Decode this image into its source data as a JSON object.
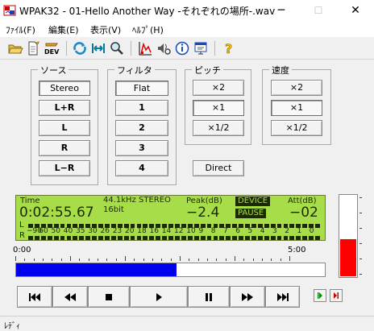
{
  "window": {
    "title": "WPAK32 - 01-Hello Another Way -それぞれの場所-.wav",
    "minimize": "─",
    "maximize": "☐",
    "close": "✕"
  },
  "menu": [
    {
      "label": "ﾌｧｲﾙ(F)"
    },
    {
      "label": "編集(E)"
    },
    {
      "label": "表示(V)"
    },
    {
      "label": "ﾍﾙﾌﾟ(H)"
    }
  ],
  "toolbar": {
    "icons": [
      "open-folder-icon",
      "new-document-icon",
      "dev-icon",
      "repeat-icon",
      "fit-width-icon",
      "zoom-icon",
      "spectrum-icon",
      "speaker-settings-icon",
      "info-icon",
      "window-icon",
      "help-icon"
    ],
    "dev_label": "DEV"
  },
  "source": {
    "title": "ソース",
    "buttons": [
      {
        "label": "Stereo",
        "pressed": true
      },
      {
        "label": "L+R",
        "pressed": false
      },
      {
        "label": "L",
        "pressed": false
      },
      {
        "label": "R",
        "pressed": false
      },
      {
        "label": "L−R",
        "pressed": false
      }
    ]
  },
  "filter": {
    "title": "フィルタ",
    "buttons": [
      {
        "label": "Flat",
        "pressed": true
      },
      {
        "label": "1",
        "pressed": false
      },
      {
        "label": "2",
        "pressed": false
      },
      {
        "label": "3",
        "pressed": false
      },
      {
        "label": "4",
        "pressed": false
      }
    ]
  },
  "pitch": {
    "title": "ピッチ",
    "buttons": [
      {
        "label": "×2",
        "pressed": false
      },
      {
        "label": "×1",
        "pressed": true
      },
      {
        "label": "×1/2",
        "pressed": false
      }
    ]
  },
  "speed": {
    "title": "速度",
    "buttons": [
      {
        "label": "×2",
        "pressed": false
      },
      {
        "label": "×1",
        "pressed": true
      },
      {
        "label": "×1/2",
        "pressed": false
      }
    ]
  },
  "direct_label": "Direct",
  "lcd": {
    "time_label": "Time",
    "time": "0:02:55.67",
    "format_line1": "44.1kHz STEREO",
    "format_line2": "16bit",
    "peak_label": "Peak(dB)",
    "peak": "−2.4",
    "device_label": "DEVICE",
    "pause_label": "PAUSE",
    "att_label": "Att(dB)",
    "att": "−02",
    "channel_l": "L",
    "channel_r": "R",
    "scale": [
      "−90",
      "60",
      "50",
      "40",
      "35",
      "30",
      "26",
      "23",
      "20",
      "18",
      "16",
      "14",
      "12",
      "10",
      "9",
      "8",
      "7",
      "6",
      "5",
      "4",
      "3",
      "2",
      "1",
      "0"
    ],
    "bg_color": "#a8dd4a"
  },
  "meter": {
    "level": 0.45,
    "color": "#ff0000"
  },
  "timeline": {
    "start_label": "0:00",
    "end_label": "5:00",
    "progress": 0.52,
    "fill_color": "#0000ee"
  },
  "transport": [
    {
      "name": "skip-to-start",
      "glyph": "⏮"
    },
    {
      "name": "rewind",
      "glyph": "⏪"
    },
    {
      "name": "stop",
      "glyph": "■"
    },
    {
      "name": "play",
      "glyph": "▶"
    },
    {
      "name": "pause",
      "glyph": "⏸"
    },
    {
      "name": "fast-forward",
      "glyph": "⏩"
    },
    {
      "name": "skip-to-end",
      "glyph": "⏭"
    }
  ],
  "status": {
    "text": "ﾚﾃﾞｨ"
  }
}
